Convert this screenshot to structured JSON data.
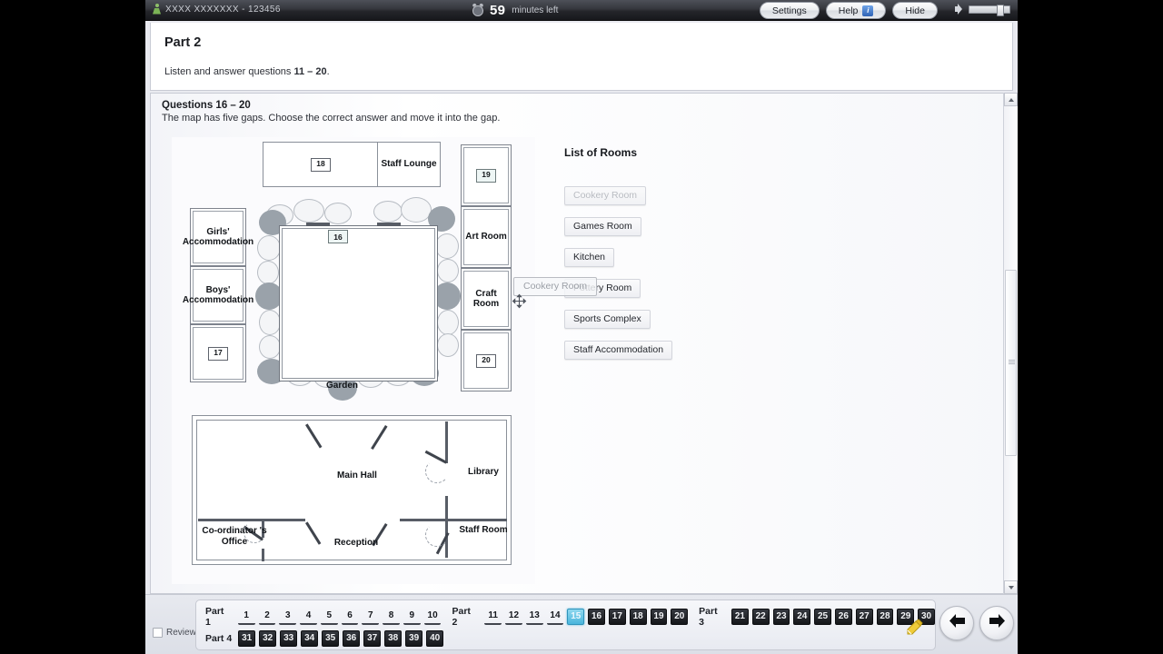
{
  "topbar": {
    "user_icon": "user-icon",
    "user_text": "XXXX XXXXXXX - 123456",
    "clock_icon": "clock-icon",
    "timer_value": "59",
    "timer_unit": "minutes left",
    "settings_label": "Settings",
    "help_label": "Help",
    "help_badge": "i",
    "hide_label": "Hide",
    "speaker_icon": "speaker-icon"
  },
  "header": {
    "part_title": "Part 2",
    "instruction_pre": "Listen and answer questions ",
    "instruction_range": "11 – 20",
    "instruction_post": "."
  },
  "question": {
    "heading": "Questions 16 – 20",
    "instruction": "The map has five gaps. Choose the correct answer and move it into the gap."
  },
  "map": {
    "rooms": [
      {
        "label": "Staff Lounge"
      },
      {
        "label": "Girls' Accommodation"
      },
      {
        "label": "Boys' Accommodation"
      },
      {
        "label": "Art Room"
      },
      {
        "label": "Craft Room"
      },
      {
        "label": "Garden"
      },
      {
        "label": "Main Hall"
      },
      {
        "label": "Library"
      },
      {
        "label": "Co-ordinator 's Office"
      },
      {
        "label": "Reception"
      },
      {
        "label": "Staff Room"
      }
    ],
    "gaps": [
      {
        "number": "16"
      },
      {
        "number": "17"
      },
      {
        "number": "18"
      },
      {
        "number": "19"
      },
      {
        "number": "20"
      }
    ]
  },
  "rooms_panel": {
    "title": "List of Rooms",
    "items": [
      {
        "label": "Cookery Room",
        "dragging": true
      },
      {
        "label": "Games Room",
        "dragging": false
      },
      {
        "label": "Kitchen",
        "dragging": false
      },
      {
        "label": "Pottery Room",
        "dragging": false
      },
      {
        "label": "Sports Complex",
        "dragging": false
      },
      {
        "label": "Staff Accommodation",
        "dragging": false
      }
    ],
    "drag_ghost_label": "Cookery Room",
    "drag_cursor_icon": "move-cursor"
  },
  "footer": {
    "review_label": "Review",
    "note_icon": "note-pencil-icon",
    "prev_icon": "arrow-left-icon",
    "next_icon": "arrow-right-icon",
    "groups": [
      {
        "part_label": "Part 1",
        "items": [
          {
            "n": "1",
            "state": "done"
          },
          {
            "n": "2",
            "state": "done"
          },
          {
            "n": "3",
            "state": "done"
          },
          {
            "n": "4",
            "state": "done"
          },
          {
            "n": "5",
            "state": "done"
          },
          {
            "n": "6",
            "state": "done"
          },
          {
            "n": "7",
            "state": "done"
          },
          {
            "n": "8",
            "state": "done"
          },
          {
            "n": "9",
            "state": "done"
          },
          {
            "n": "10",
            "state": "done"
          }
        ]
      },
      {
        "part_label": "Part 2",
        "items": [
          {
            "n": "11",
            "state": "done"
          },
          {
            "n": "12",
            "state": "done"
          },
          {
            "n": "13",
            "state": "done"
          },
          {
            "n": "14",
            "state": "done"
          },
          {
            "n": "15",
            "state": "current"
          },
          {
            "n": "16",
            "state": "todo"
          },
          {
            "n": "17",
            "state": "todo"
          },
          {
            "n": "18",
            "state": "todo"
          },
          {
            "n": "19",
            "state": "todo"
          },
          {
            "n": "20",
            "state": "todo"
          }
        ]
      },
      {
        "part_label": "Part 3",
        "items": [
          {
            "n": "21",
            "state": "todo"
          },
          {
            "n": "22",
            "state": "todo"
          },
          {
            "n": "23",
            "state": "todo"
          },
          {
            "n": "24",
            "state": "todo"
          },
          {
            "n": "25",
            "state": "todo"
          },
          {
            "n": "26",
            "state": "todo"
          },
          {
            "n": "27",
            "state": "todo"
          },
          {
            "n": "28",
            "state": "todo"
          },
          {
            "n": "29",
            "state": "todo"
          },
          {
            "n": "30",
            "state": "todo"
          }
        ]
      },
      {
        "part_label": "Part 4",
        "items": [
          {
            "n": "31",
            "state": "todo"
          },
          {
            "n": "32",
            "state": "todo"
          },
          {
            "n": "33",
            "state": "todo"
          },
          {
            "n": "34",
            "state": "todo"
          },
          {
            "n": "35",
            "state": "todo"
          },
          {
            "n": "36",
            "state": "todo"
          },
          {
            "n": "37",
            "state": "todo"
          },
          {
            "n": "38",
            "state": "todo"
          },
          {
            "n": "39",
            "state": "todo"
          },
          {
            "n": "40",
            "state": "todo"
          }
        ]
      }
    ]
  },
  "colors": {
    "current_accent": "#4ab5dc",
    "todo_bg": "#15171a",
    "topbar_bg": "#25262b",
    "note_icon": "#e8c02e"
  }
}
